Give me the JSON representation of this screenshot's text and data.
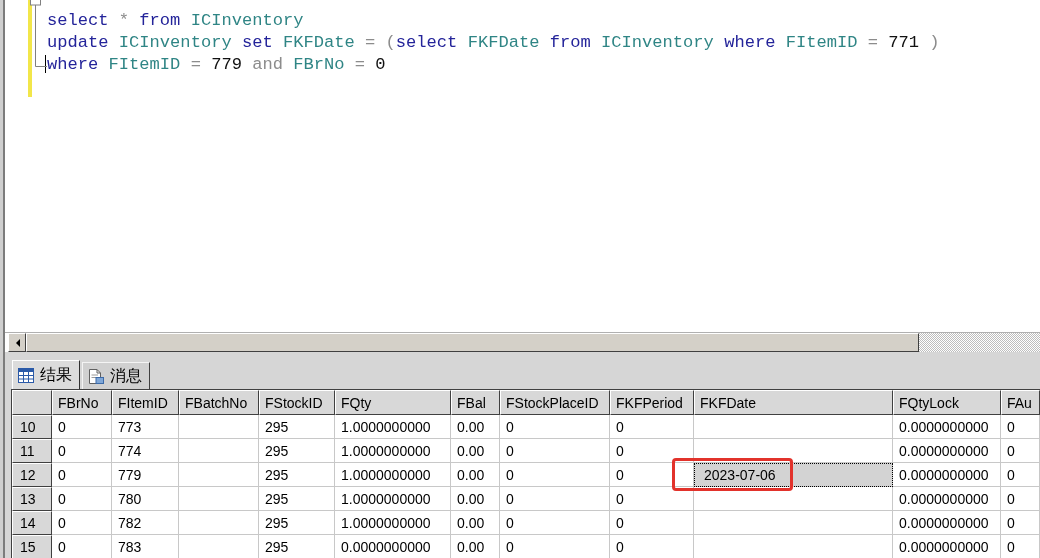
{
  "editor": {
    "lines": [
      {
        "caret": false,
        "tokens": [
          {
            "text": "select",
            "kind": "keyword"
          },
          {
            "text": " * ",
            "kind": "operator"
          },
          {
            "text": "from",
            "kind": "keyword"
          },
          {
            "text": " ICInventory",
            "kind": "identifier"
          }
        ]
      },
      {
        "caret": false,
        "tokens": [
          {
            "text": "update",
            "kind": "keyword"
          },
          {
            "text": " ICInventory ",
            "kind": "identifier"
          },
          {
            "text": "set",
            "kind": "keyword"
          },
          {
            "text": " FKFDate",
            "kind": "identifier"
          },
          {
            "text": " = (",
            "kind": "operator"
          },
          {
            "text": "select",
            "kind": "keyword"
          },
          {
            "text": " FKFDate ",
            "kind": "identifier"
          },
          {
            "text": "from",
            "kind": "keyword"
          },
          {
            "text": " ICInventory ",
            "kind": "identifier"
          },
          {
            "text": "where",
            "kind": "keyword"
          },
          {
            "text": " FItemID",
            "kind": "identifier"
          },
          {
            "text": " = ",
            "kind": "operator"
          },
          {
            "text": "771",
            "kind": "number"
          },
          {
            "text": " )",
            "kind": "operator"
          }
        ]
      },
      {
        "caret": true,
        "tokens": [
          {
            "text": "where",
            "kind": "keyword"
          },
          {
            "text": " FItemID",
            "kind": "identifier"
          },
          {
            "text": " = ",
            "kind": "operator"
          },
          {
            "text": "779",
            "kind": "number"
          },
          {
            "text": " and ",
            "kind": "operator"
          },
          {
            "text": "FBrNo",
            "kind": "identifier"
          },
          {
            "text": " = ",
            "kind": "operator"
          },
          {
            "text": "0",
            "kind": "number"
          }
        ]
      }
    ]
  },
  "tabs": [
    {
      "label": "结果",
      "selected": true
    },
    {
      "label": "消息",
      "selected": false
    }
  ],
  "grid": {
    "columns": [
      "FBrNo",
      "FItemID",
      "FBatchNo",
      "FStockID",
      "FQty",
      "FBal",
      "FStockPlaceID",
      "FKFPeriod",
      "FKFDate",
      "FQtyLock",
      "FAu"
    ],
    "rows": [
      {
        "number": "10",
        "cells": [
          {
            "text": "0",
            "selected": false,
            "circled": false
          },
          {
            "text": "773",
            "selected": false,
            "circled": false
          },
          {
            "selected": false,
            "circled": false
          },
          {
            "text": "295",
            "selected": false,
            "circled": false
          },
          {
            "text": "1.0000000000",
            "selected": false,
            "circled": false
          },
          {
            "text": "0.00",
            "selected": false,
            "circled": false
          },
          {
            "text": "0",
            "selected": false,
            "circled": false
          },
          {
            "text": "0",
            "selected": false,
            "circled": false
          },
          {
            "selected": false,
            "circled": false
          },
          {
            "text": "0.0000000000",
            "selected": false,
            "circled": false
          },
          {
            "text": "0",
            "selected": false,
            "circled": false
          }
        ]
      },
      {
        "number": "11",
        "cells": [
          {
            "text": "0",
            "selected": false,
            "circled": false
          },
          {
            "text": "774",
            "selected": false,
            "circled": false
          },
          {
            "selected": false,
            "circled": false
          },
          {
            "text": "295",
            "selected": false,
            "circled": false
          },
          {
            "text": "1.0000000000",
            "selected": false,
            "circled": false
          },
          {
            "text": "0.00",
            "selected": false,
            "circled": false
          },
          {
            "text": "0",
            "selected": false,
            "circled": false
          },
          {
            "text": "0",
            "selected": false,
            "circled": false
          },
          {
            "selected": false,
            "circled": false
          },
          {
            "text": "0.0000000000",
            "selected": false,
            "circled": false
          },
          {
            "text": "0",
            "selected": false,
            "circled": false
          }
        ]
      },
      {
        "number": "12",
        "cells": [
          {
            "text": "0",
            "selected": false,
            "circled": false
          },
          {
            "text": "779",
            "selected": false,
            "circled": false
          },
          {
            "selected": false,
            "circled": false
          },
          {
            "text": "295",
            "selected": false,
            "circled": false
          },
          {
            "text": "1.0000000000",
            "selected": false,
            "circled": false
          },
          {
            "text": "0.00",
            "selected": false,
            "circled": false
          },
          {
            "text": "0",
            "selected": false,
            "circled": false
          },
          {
            "text": "0",
            "selected": false,
            "circled": false
          },
          {
            "text": "2023-07-06",
            "selected": true,
            "circled": true
          },
          {
            "text": "0.0000000000",
            "selected": false,
            "circled": false
          },
          {
            "text": "0",
            "selected": false,
            "circled": false
          }
        ]
      },
      {
        "number": "13",
        "cells": [
          {
            "text": "0",
            "selected": false,
            "circled": false
          },
          {
            "text": "780",
            "selected": false,
            "circled": false
          },
          {
            "selected": false,
            "circled": false
          },
          {
            "text": "295",
            "selected": false,
            "circled": false
          },
          {
            "text": "1.0000000000",
            "selected": false,
            "circled": false
          },
          {
            "text": "0.00",
            "selected": false,
            "circled": false
          },
          {
            "text": "0",
            "selected": false,
            "circled": false
          },
          {
            "text": "0",
            "selected": false,
            "circled": false
          },
          {
            "selected": false,
            "circled": false
          },
          {
            "text": "0.0000000000",
            "selected": false,
            "circled": false
          },
          {
            "text": "0",
            "selected": false,
            "circled": false
          }
        ]
      },
      {
        "number": "14",
        "cells": [
          {
            "text": "0",
            "selected": false,
            "circled": false
          },
          {
            "text": "782",
            "selected": false,
            "circled": false
          },
          {
            "selected": false,
            "circled": false
          },
          {
            "text": "295",
            "selected": false,
            "circled": false
          },
          {
            "text": "1.0000000000",
            "selected": false,
            "circled": false
          },
          {
            "text": "0.00",
            "selected": false,
            "circled": false
          },
          {
            "text": "0",
            "selected": false,
            "circled": false
          },
          {
            "text": "0",
            "selected": false,
            "circled": false
          },
          {
            "selected": false,
            "circled": false
          },
          {
            "text": "0.0000000000",
            "selected": false,
            "circled": false
          },
          {
            "text": "0",
            "selected": false,
            "circled": false
          }
        ]
      },
      {
        "number": "15",
        "cells": [
          {
            "text": "0",
            "selected": false,
            "circled": false
          },
          {
            "text": "783",
            "selected": false,
            "circled": false
          },
          {
            "selected": false,
            "circled": false
          },
          {
            "text": "295",
            "selected": false,
            "circled": false
          },
          {
            "text": "0.0000000000",
            "selected": false,
            "circled": false
          },
          {
            "text": "0.00",
            "selected": false,
            "circled": false
          },
          {
            "text": "0",
            "selected": false,
            "circled": false
          },
          {
            "text": "0",
            "selected": false,
            "circled": false
          },
          {
            "selected": false,
            "circled": false
          },
          {
            "text": "0.0000000000",
            "selected": false,
            "circled": false
          },
          {
            "text": "0",
            "selected": false,
            "circled": false
          }
        ]
      }
    ]
  }
}
